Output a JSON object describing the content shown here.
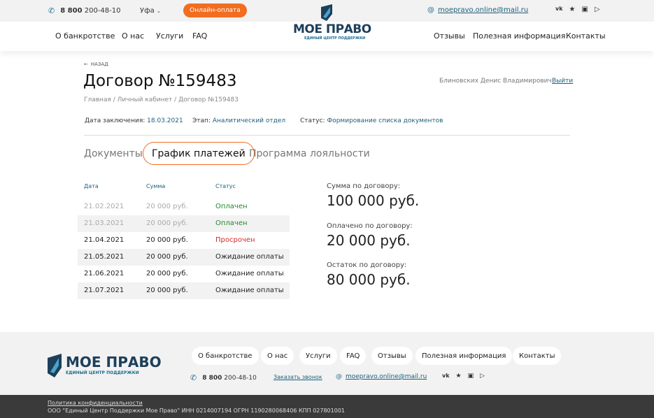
{
  "header": {
    "phone_bold": "8 800",
    "phone_rest": "200-48-10",
    "city": "Уфа",
    "pay_button": "Онлайн-оплата",
    "email": "moepravo.online@mail.ru",
    "socials": [
      "vk-icon",
      "odnoklassniki-icon",
      "instagram-icon",
      "youtube-icon"
    ]
  },
  "nav": {
    "left": [
      "О банкротстве",
      "О нас",
      "Услуги",
      "FAQ"
    ],
    "right": [
      "Отзывы",
      "Полезная информация",
      "Контакты"
    ]
  },
  "logo": {
    "name": "МОЕ ПРАВО",
    "subtitle": "ЕДИНЫЙ ЦЕНТР ПОДДЕРЖКИ"
  },
  "page": {
    "back": "НАЗАД",
    "title": "Договор №159483",
    "user_name": "Блиновских Денис Владимирович",
    "logout": "Выйти",
    "breadcrumb": [
      "Главная",
      "Личный кабинет",
      "Договор №159483"
    ],
    "date_label": "Дата заключения:",
    "date_value": "18.03.2021",
    "stage_label": "Этап:",
    "stage_value": "Аналитический отдел",
    "status_label": "Статус:",
    "status_value": "Формирование списка документов"
  },
  "tabs": [
    "Документы",
    "График платежей",
    "Программа лояльности"
  ],
  "payments": {
    "headers": [
      "Дата",
      "Сумма",
      "Статус"
    ],
    "rows": [
      {
        "date": "21.02.2021",
        "amount": "20 000 руб.",
        "status": "Оплачен"
      },
      {
        "date": "21.03.2021",
        "amount": "20 000 руб.",
        "status": "Оплачен"
      },
      {
        "date": "21.04.2021",
        "amount": "20 000 руб.",
        "status": "Просрочен"
      },
      {
        "date": "21.05.2021",
        "amount": "20 000 руб.",
        "status": "Ожидание оплаты"
      },
      {
        "date": "21.06.2021",
        "amount": "20 000 руб.",
        "status": "Ожидание оплаты"
      },
      {
        "date": "21.07.2021",
        "amount": "20 000 руб.",
        "status": "Ожидание оплаты"
      }
    ]
  },
  "summary": [
    {
      "label": "Сумма по договору:",
      "value": "100 000 руб."
    },
    {
      "label": "Оплачено по договору:",
      "value": "20 000 руб."
    },
    {
      "label": "Остаток по договору:",
      "value": "80 000 руб."
    }
  ],
  "footer": {
    "nav": [
      "О банкротстве",
      "О нас",
      "Услуги",
      "FAQ",
      "Отзывы",
      "Полезная информация",
      "Контакты"
    ],
    "phone_bold": "8 800",
    "phone_rest": "200-48-10",
    "callback": "Заказать звонок",
    "email": "moepravo.online@mail.ru",
    "policy": "Политика конфиденциальности",
    "legal": "ООО \"Единый Центр Поддержки Мое Право\" ИНН 0214007194 ОГРН 1190280068406 КПП 027801001"
  },
  "colors": {
    "accent": "#f26d1f",
    "link": "#1b5f7c",
    "paid": "#21882e",
    "overdue": "#d62828",
    "logo": "#1d3f5c"
  }
}
